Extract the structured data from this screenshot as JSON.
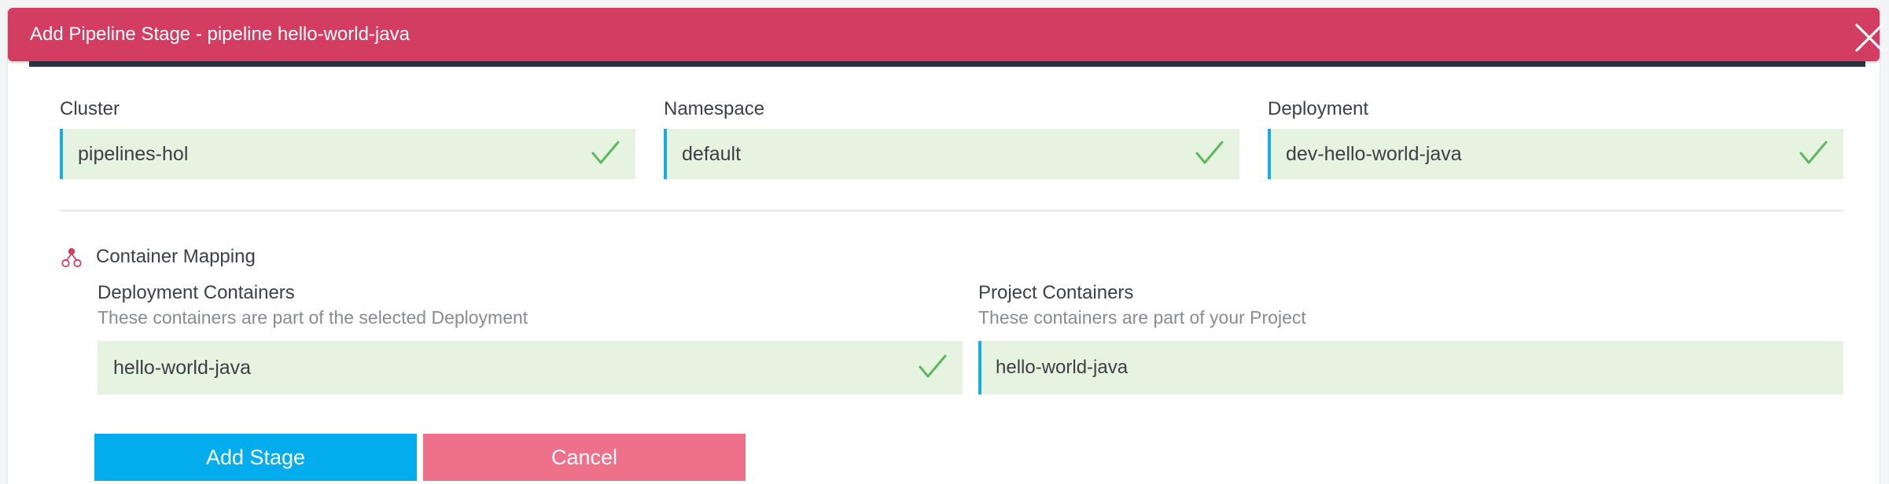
{
  "dialog": {
    "title": "Add Pipeline Stage - pipeline hello-world-java",
    "close_icon": "close-icon",
    "accent_color": "#d33d61"
  },
  "fields": {
    "cluster": {
      "label": "Cluster",
      "value": "pipelines-hol",
      "status": "valid"
    },
    "namespace": {
      "label": "Namespace",
      "value": "default",
      "status": "valid"
    },
    "deployment": {
      "label": "Deployment",
      "value": "dev-hello-world-java",
      "status": "valid"
    }
  },
  "container_mapping": {
    "title": "Container Mapping",
    "icon": "cluster-nodes-icon",
    "deployment_containers": {
      "label": "Deployment Containers",
      "description": "These containers are part of the selected Deployment",
      "value": "hello-world-java",
      "status": "valid"
    },
    "project_containers": {
      "label": "Project Containers",
      "description": "These containers are part of your Project",
      "value": "hello-world-java"
    }
  },
  "actions": {
    "add_stage_label": "Add Stage",
    "cancel_label": "Cancel",
    "primary_color": "#03aced",
    "secondary_color": "#ef708b"
  }
}
